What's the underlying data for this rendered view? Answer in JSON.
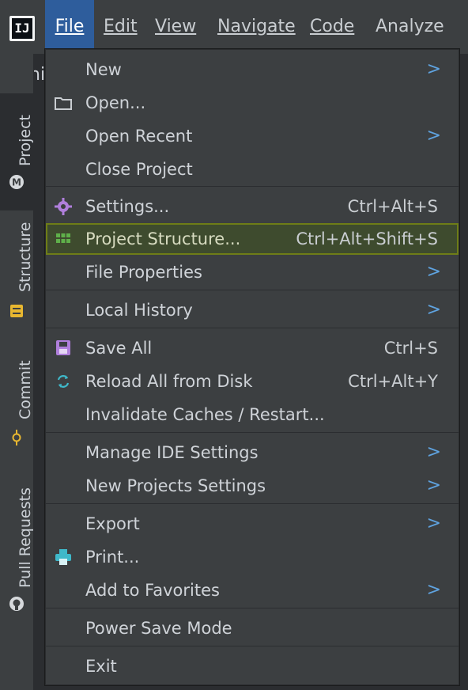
{
  "app": {
    "logo_text": "IJ"
  },
  "menubar": {
    "items": [
      {
        "label": "File",
        "mnemonic": "F",
        "active": true
      },
      {
        "label": "Edit",
        "mnemonic": "E"
      },
      {
        "label": "View",
        "mnemonic": "V"
      },
      {
        "label": "Navigate",
        "mnemonic": "N"
      },
      {
        "label": "Code",
        "mnemonic": "C"
      },
      {
        "label": "Analyze",
        "mnemonic": "z"
      }
    ]
  },
  "toolbar_peek": "Ani",
  "left_tabs": [
    {
      "label": "Project",
      "icon": "maven-m-icon",
      "active": true
    },
    {
      "label": "Structure",
      "icon": "structure-icon"
    },
    {
      "label": "Commit",
      "icon": "commit-icon"
    },
    {
      "label": "Pull Requests",
      "icon": "github-icon"
    }
  ],
  "file_menu": {
    "items": [
      {
        "label": "New",
        "submenu": true
      },
      {
        "label": "Open...",
        "icon": "folder-icon"
      },
      {
        "label": "Open Recent",
        "submenu": true
      },
      {
        "label": "Close Project"
      },
      {
        "label": "Settings...",
        "icon": "gear-icon",
        "shortcut": "Ctrl+Alt+S"
      },
      {
        "label": "Project Structure...",
        "icon": "project-structure-icon",
        "shortcut": "Ctrl+Alt+Shift+S",
        "selected": true
      },
      {
        "label": "File Properties",
        "submenu": true
      },
      {
        "label": "Local History",
        "submenu": true
      },
      {
        "label": "Save All",
        "icon": "save-icon",
        "shortcut": "Ctrl+S"
      },
      {
        "label": "Reload All from Disk",
        "icon": "reload-icon",
        "shortcut": "Ctrl+Alt+Y"
      },
      {
        "label": "Invalidate Caches / Restart..."
      },
      {
        "label": "Manage IDE Settings",
        "submenu": true
      },
      {
        "label": "New Projects Settings",
        "submenu": true
      },
      {
        "label": "Export",
        "submenu": true
      },
      {
        "label": "Print...",
        "icon": "printer-icon"
      },
      {
        "label": "Add to Favorites",
        "submenu": true
      },
      {
        "label": "Power Save Mode"
      },
      {
        "label": "Exit"
      }
    ],
    "submenu_arrow": ">"
  },
  "colors": {
    "menubar_bg": "#3c3f41",
    "active_menu_bg": "#2e5d9c",
    "selected_row_bg": "#3e4b2e",
    "selected_row_border": "#6e7d17",
    "arrow": "#5fa3e0",
    "icon_purple": "#b07fdc",
    "icon_teal": "#3fb8c9"
  }
}
